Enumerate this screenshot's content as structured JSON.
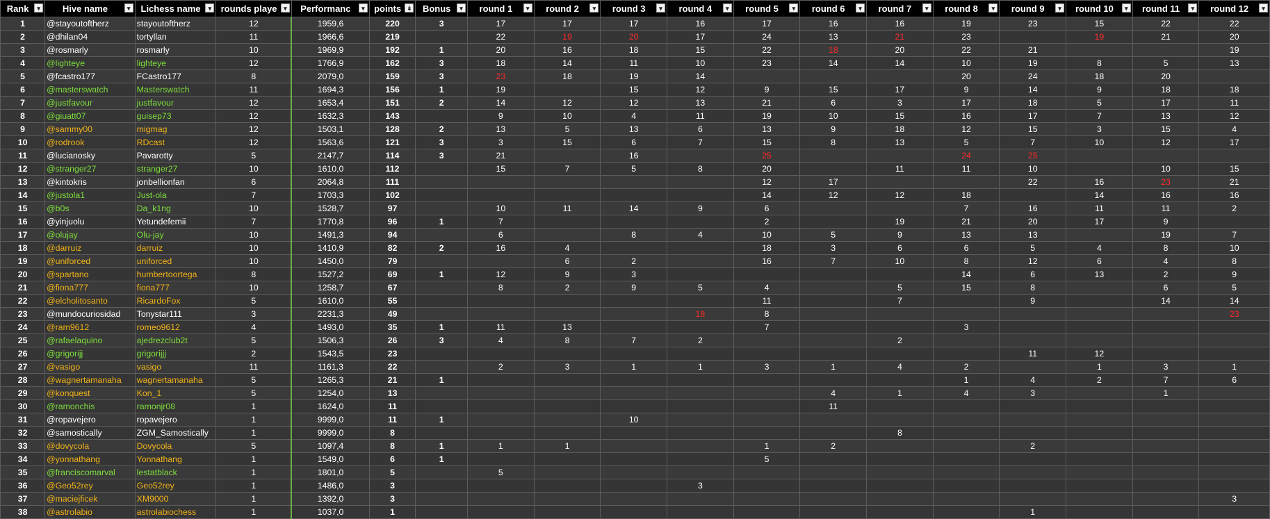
{
  "headers": [
    "Rank",
    "Hive name",
    "Lichess name",
    "rounds playe",
    "Performanc",
    "points",
    "Bonus",
    "round 1",
    "round 2",
    "round 3",
    "round 4",
    "round 5",
    "round 6",
    "round 7",
    "round 8",
    "round 9",
    "round 10",
    "round 11",
    "round 12"
  ],
  "header_icons": [
    "filter-dropdown-icon",
    "sort-descending-icon"
  ],
  "colors": {
    "green": "#7ede3c",
    "orange": "#f2b418",
    "red": "#ff2b2b",
    "white": "#ffffff"
  },
  "rows": [
    {
      "rank": "1",
      "hive": "@stayoutoftherz",
      "lichess": "stayoutoftherz",
      "color": "w",
      "rounds": "12",
      "perf": "1959,6",
      "points": "220",
      "bonus": "3",
      "r": [
        "17",
        "17",
        "17",
        "16",
        "17",
        "16",
        "16",
        "19",
        "23",
        "15",
        "22",
        "22"
      ],
      "red": []
    },
    {
      "rank": "2",
      "hive": "@dhilan04",
      "lichess": "tortyllan",
      "color": "w",
      "rounds": "11",
      "perf": "1966,6",
      "points": "219",
      "bonus": "",
      "r": [
        "22",
        "19",
        "20",
        "17",
        "24",
        "13",
        "21",
        "23",
        "",
        "19",
        "21",
        "20"
      ],
      "red": [
        1,
        2,
        6,
        9
      ]
    },
    {
      "rank": "3",
      "hive": "@rosmarly",
      "lichess": "rosmarly",
      "color": "w",
      "rounds": "10",
      "perf": "1969,9",
      "points": "192",
      "bonus": "1",
      "r": [
        "20",
        "16",
        "18",
        "15",
        "22",
        "18",
        "20",
        "22",
        "21",
        "",
        "",
        "19"
      ],
      "red": [
        5
      ]
    },
    {
      "rank": "4",
      "hive": "@lighteye",
      "lichess": "lighteye",
      "color": "g",
      "rounds": "12",
      "perf": "1766,9",
      "points": "162",
      "bonus": "3",
      "r": [
        "18",
        "14",
        "11",
        "10",
        "23",
        "14",
        "14",
        "10",
        "19",
        "8",
        "5",
        "13"
      ],
      "red": []
    },
    {
      "rank": "5",
      "hive": "@fcastro177",
      "lichess": "FCastro177",
      "color": "w",
      "rounds": "8",
      "perf": "2079,0",
      "points": "159",
      "bonus": "3",
      "r": [
        "23",
        "18",
        "19",
        "14",
        "",
        "",
        "",
        "20",
        "24",
        "18",
        "20",
        ""
      ],
      "red": [
        0
      ]
    },
    {
      "rank": "6",
      "hive": "@masterswatch",
      "lichess": "Masterswatch",
      "color": "g",
      "rounds": "11",
      "perf": "1694,3",
      "points": "156",
      "bonus": "1",
      "r": [
        "19",
        "",
        "15",
        "12",
        "9",
        "15",
        "17",
        "9",
        "14",
        "9",
        "18",
        "18"
      ],
      "red": []
    },
    {
      "rank": "7",
      "hive": "@justfavour",
      "lichess": "justfavour",
      "color": "g",
      "rounds": "12",
      "perf": "1653,4",
      "points": "151",
      "bonus": "2",
      "r": [
        "14",
        "12",
        "12",
        "13",
        "21",
        "6",
        "3",
        "17",
        "18",
        "5",
        "17",
        "11"
      ],
      "red": []
    },
    {
      "rank": "8",
      "hive": "@giuatt07",
      "lichess": "guisep73",
      "color": "g",
      "rounds": "12",
      "perf": "1632,3",
      "points": "143",
      "bonus": "",
      "r": [
        "9",
        "10",
        "4",
        "11",
        "19",
        "10",
        "15",
        "16",
        "17",
        "7",
        "13",
        "12"
      ],
      "red": []
    },
    {
      "rank": "9",
      "hive": "@sammy00",
      "lichess": "migmag",
      "color": "o",
      "rounds": "12",
      "perf": "1503,1",
      "points": "128",
      "bonus": "2",
      "r": [
        "13",
        "5",
        "13",
        "6",
        "13",
        "9",
        "18",
        "12",
        "15",
        "3",
        "15",
        "4"
      ],
      "red": []
    },
    {
      "rank": "10",
      "hive": "@rodrook",
      "lichess": "RDcast",
      "color": "o",
      "rounds": "12",
      "perf": "1563,6",
      "points": "121",
      "bonus": "3",
      "r": [
        "3",
        "15",
        "6",
        "7",
        "15",
        "8",
        "13",
        "5",
        "7",
        "10",
        "12",
        "17"
      ],
      "red": []
    },
    {
      "rank": "11",
      "hive": "@lucianosky",
      "lichess": "Pavarotty",
      "color": "w",
      "rounds": "5",
      "perf": "2147,7",
      "points": "114",
      "bonus": "3",
      "r": [
        "21",
        "",
        "16",
        "",
        "25",
        "",
        "",
        "24",
        "25",
        "",
        "",
        ""
      ],
      "red": [
        4,
        7,
        8
      ]
    },
    {
      "rank": "12",
      "hive": "@stranger27",
      "lichess": "stranger27",
      "color": "g",
      "rounds": "10",
      "perf": "1610,0",
      "points": "112",
      "bonus": "",
      "r": [
        "15",
        "7",
        "5",
        "8",
        "20",
        "",
        "11",
        "11",
        "10",
        "",
        "10",
        "15"
      ],
      "red": []
    },
    {
      "rank": "13",
      "hive": "@kintokris",
      "lichess": "jonbellionfan",
      "color": "w",
      "rounds": "6",
      "perf": "2064,8",
      "points": "111",
      "bonus": "",
      "r": [
        "",
        "",
        "",
        "",
        "12",
        "17",
        "",
        "",
        "22",
        "16",
        "23",
        "21"
      ],
      "red": [
        10
      ]
    },
    {
      "rank": "14",
      "hive": "@justola1",
      "lichess": "Just-ola",
      "color": "g",
      "rounds": "7",
      "perf": "1703,3",
      "points": "102",
      "bonus": "",
      "r": [
        "",
        "",
        "",
        "",
        "14",
        "12",
        "12",
        "18",
        "",
        "14",
        "16",
        "16"
      ],
      "red": []
    },
    {
      "rank": "15",
      "hive": "@b0s",
      "lichess": "Da_k1ng",
      "color": "g",
      "rounds": "10",
      "perf": "1528,7",
      "points": "97",
      "bonus": "",
      "r": [
        "10",
        "11",
        "14",
        "9",
        "6",
        "",
        "",
        "7",
        "16",
        "11",
        "11",
        "2"
      ],
      "red": []
    },
    {
      "rank": "16",
      "hive": "@yinjuolu",
      "lichess": "Yetundefemii",
      "color": "w",
      "rounds": "7",
      "perf": "1770,8",
      "points": "96",
      "bonus": "1",
      "r": [
        "7",
        "",
        "",
        "",
        "2",
        "",
        "19",
        "21",
        "20",
        "17",
        "9",
        ""
      ],
      "red": []
    },
    {
      "rank": "17",
      "hive": "@olujay",
      "lichess": "Olu-jay",
      "color": "g",
      "rounds": "10",
      "perf": "1491,3",
      "points": "94",
      "bonus": "",
      "r": [
        "6",
        "",
        "8",
        "4",
        "10",
        "5",
        "9",
        "13",
        "13",
        "",
        "19",
        "7"
      ],
      "red": []
    },
    {
      "rank": "18",
      "hive": "@darruiz",
      "lichess": "darruiz",
      "color": "o",
      "rounds": "10",
      "perf": "1410,9",
      "points": "82",
      "bonus": "2",
      "r": [
        "16",
        "4",
        "",
        "",
        "18",
        "3",
        "6",
        "6",
        "5",
        "4",
        "8",
        "10"
      ],
      "red": []
    },
    {
      "rank": "19",
      "hive": "@uniforced",
      "lichess": "uniforced",
      "color": "o",
      "rounds": "10",
      "perf": "1450,0",
      "points": "79",
      "bonus": "",
      "r": [
        "",
        "6",
        "2",
        "",
        "16",
        "7",
        "10",
        "8",
        "12",
        "6",
        "4",
        "8"
      ],
      "red": []
    },
    {
      "rank": "20",
      "hive": "@spartano",
      "lichess": "humbertoortega",
      "color": "o",
      "rounds": "8",
      "perf": "1527,2",
      "points": "69",
      "bonus": "1",
      "r": [
        "12",
        "9",
        "3",
        "",
        "",
        "",
        "",
        "14",
        "6",
        "13",
        "2",
        "9"
      ],
      "red": []
    },
    {
      "rank": "21",
      "hive": "@fiona777",
      "lichess": "fiona777",
      "color": "o",
      "rounds": "10",
      "perf": "1258,7",
      "points": "67",
      "bonus": "",
      "r": [
        "8",
        "2",
        "9",
        "5",
        "4",
        "",
        "5",
        "15",
        "8",
        "",
        "6",
        "5"
      ],
      "red": []
    },
    {
      "rank": "22",
      "hive": "@elcholitosanto",
      "lichess": "RicardoFox",
      "color": "o",
      "rounds": "5",
      "perf": "1610,0",
      "points": "55",
      "bonus": "",
      "r": [
        "",
        "",
        "",
        "",
        "11",
        "",
        "7",
        "",
        "9",
        "",
        "14",
        "14"
      ],
      "red": []
    },
    {
      "rank": "23",
      "hive": "@mundocuriosidad",
      "lichess": "Tonystar111",
      "color": "w",
      "rounds": "3",
      "perf": "2231,3",
      "points": "49",
      "bonus": "",
      "r": [
        "",
        "",
        "",
        "18",
        "8",
        "",
        "",
        "",
        "",
        "",
        "",
        "23"
      ],
      "red": [
        3,
        11
      ]
    },
    {
      "rank": "24",
      "hive": "@ram9612",
      "lichess": "romeo9612",
      "color": "o",
      "rounds": "4",
      "perf": "1493,0",
      "points": "35",
      "bonus": "1",
      "r": [
        "11",
        "13",
        "",
        "",
        "7",
        "",
        "",
        "3",
        "",
        "",
        "",
        ""
      ],
      "red": []
    },
    {
      "rank": "25",
      "hive": "@rafaelaquino",
      "lichess": "ajedrezclub2t",
      "color": "g",
      "rounds": "5",
      "perf": "1506,3",
      "points": "26",
      "bonus": "3",
      "r": [
        "4",
        "8",
        "7",
        "2",
        "",
        "",
        "2",
        "",
        "",
        "",
        "",
        ""
      ],
      "red": []
    },
    {
      "rank": "26",
      "hive": "@grigorijj",
      "lichess": "grigorijjj",
      "color": "g",
      "rounds": "2",
      "perf": "1543,5",
      "points": "23",
      "bonus": "",
      "r": [
        "",
        "",
        "",
        "",
        "",
        "",
        "",
        "",
        "11",
        "12",
        "",
        ""
      ],
      "red": []
    },
    {
      "rank": "27",
      "hive": "@vasigo",
      "lichess": "vasigo",
      "color": "o",
      "rounds": "11",
      "perf": "1161,3",
      "points": "22",
      "bonus": "",
      "r": [
        "2",
        "3",
        "1",
        "1",
        "3",
        "1",
        "4",
        "2",
        "",
        "1",
        "3",
        "1"
      ],
      "red": []
    },
    {
      "rank": "28",
      "hive": "@wagnertamanaha",
      "lichess": "wagnertamanaha",
      "color": "o",
      "rounds": "5",
      "perf": "1265,3",
      "points": "21",
      "bonus": "1",
      "r": [
        "",
        "",
        "",
        "",
        "",
        "",
        "",
        "1",
        "4",
        "2",
        "7",
        "6"
      ],
      "red": []
    },
    {
      "rank": "29",
      "hive": "@konquest",
      "lichess": "Kon_1",
      "color": "o",
      "rounds": "5",
      "perf": "1254,0",
      "points": "13",
      "bonus": "",
      "r": [
        "",
        "",
        "",
        "",
        "",
        "4",
        "1",
        "4",
        "3",
        "",
        "1",
        ""
      ],
      "red": []
    },
    {
      "rank": "30",
      "hive": "@ramonchis",
      "lichess": "ramonjr08",
      "color": "g",
      "rounds": "1",
      "perf": "1624,0",
      "points": "11",
      "bonus": "",
      "r": [
        "",
        "",
        "",
        "",
        "",
        "11",
        "",
        "",
        "",
        "",
        "",
        ""
      ],
      "red": []
    },
    {
      "rank": "31",
      "hive": "@ropavejero",
      "lichess": "ropavejero",
      "color": "w",
      "rounds": "1",
      "perf": "9999,0",
      "points": "11",
      "bonus": "1",
      "r": [
        "",
        "",
        "10",
        "",
        "",
        "",
        "",
        "",
        "",
        "",
        "",
        ""
      ],
      "red": []
    },
    {
      "rank": "32",
      "hive": "@samostically",
      "lichess": "ZGM_Samostically",
      "color": "w",
      "rounds": "1",
      "perf": "9999,0",
      "points": "8",
      "bonus": "",
      "r": [
        "",
        "",
        "",
        "",
        "",
        "",
        "8",
        "",
        "",
        "",
        "",
        ""
      ],
      "red": []
    },
    {
      "rank": "33",
      "hive": "@dovycola",
      "lichess": "Dovycola",
      "color": "o",
      "rounds": "5",
      "perf": "1097,4",
      "points": "8",
      "bonus": "1",
      "r": [
        "1",
        "1",
        "",
        "",
        "1",
        "2",
        "",
        "",
        "2",
        "",
        "",
        ""
      ],
      "red": []
    },
    {
      "rank": "34",
      "hive": "@yonnathang",
      "lichess": "Yonnathang",
      "color": "o",
      "rounds": "1",
      "perf": "1549,0",
      "points": "6",
      "bonus": "1",
      "r": [
        "",
        "",
        "",
        "",
        "5",
        "",
        "",
        "",
        "",
        "",
        "",
        ""
      ],
      "red": []
    },
    {
      "rank": "35",
      "hive": "@franciscomarval",
      "lichess": "lestatblack",
      "color": "g",
      "rounds": "1",
      "perf": "1801,0",
      "points": "5",
      "bonus": "",
      "r": [
        "5",
        "",
        "",
        "",
        "",
        "",
        "",
        "",
        "",
        "",
        "",
        ""
      ],
      "red": []
    },
    {
      "rank": "36",
      "hive": "@Geo52rey",
      "lichess": "Geo52rey",
      "color": "o",
      "rounds": "1",
      "perf": "1486,0",
      "points": "3",
      "bonus": "",
      "r": [
        "",
        "",
        "",
        "3",
        "",
        "",
        "",
        "",
        "",
        "",
        "",
        ""
      ],
      "red": []
    },
    {
      "rank": "37",
      "hive": "@maciejficek",
      "lichess": "XM9000",
      "color": "o",
      "rounds": "1",
      "perf": "1392,0",
      "points": "3",
      "bonus": "",
      "r": [
        "",
        "",
        "",
        "",
        "",
        "",
        "",
        "",
        "",
        "",
        "",
        "3"
      ],
      "red": []
    },
    {
      "rank": "38",
      "hive": "@astrolabio",
      "lichess": "astrolabiochess",
      "color": "o",
      "rounds": "1",
      "perf": "1037,0",
      "points": "1",
      "bonus": "",
      "r": [
        "",
        "",
        "",
        "",
        "",
        "",
        "",
        "",
        "1",
        "",
        "",
        ""
      ],
      "red": []
    }
  ]
}
